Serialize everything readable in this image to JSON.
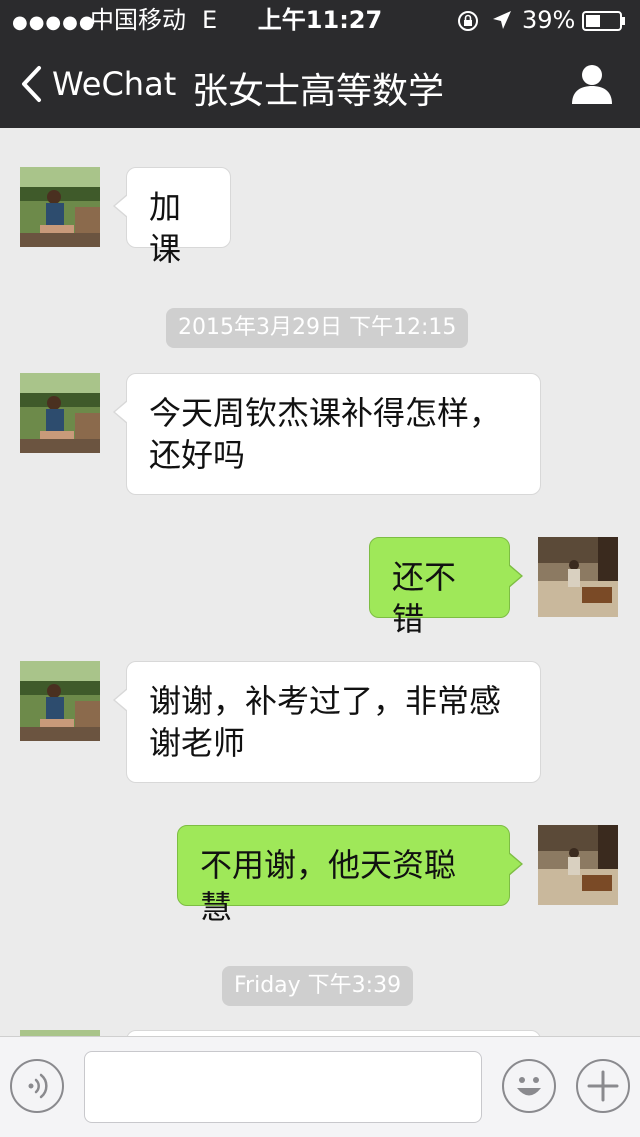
{
  "status_bar": {
    "signal_dots": "●●●●●",
    "carrier": "中国移动",
    "network": "E",
    "time": "上午11:27",
    "battery": "39%"
  },
  "nav": {
    "back_label": "WeChat",
    "title": "张女士高等数学"
  },
  "messages": [
    {
      "from": "other",
      "text": "加课"
    },
    {
      "timestamp": "2015年3月29日 下午12:15"
    },
    {
      "from": "other",
      "lines": [
        "今天周钦杰课补得怎样，",
        "还好吗"
      ]
    },
    {
      "from": "me",
      "text": "还不错"
    },
    {
      "from": "other",
      "lines": [
        "谢谢，补考过了，非常感",
        "谢老师"
      ]
    },
    {
      "from": "me",
      "text": "不用谢，他天资聪慧"
    },
    {
      "timestamp": "Friday 下午3:39"
    }
  ],
  "colors": {
    "nav_bg": "#2b2b2d",
    "chat_bg": "#ebebeb",
    "bubble_out": "#9fe859",
    "bubble_in": "#ffffff",
    "timestamp_bg": "#cfcfcf"
  },
  "input_bar": {
    "voice_icon": "voice-icon",
    "emoji_icon": "emoji-icon",
    "plus_icon": "plus-icon"
  }
}
